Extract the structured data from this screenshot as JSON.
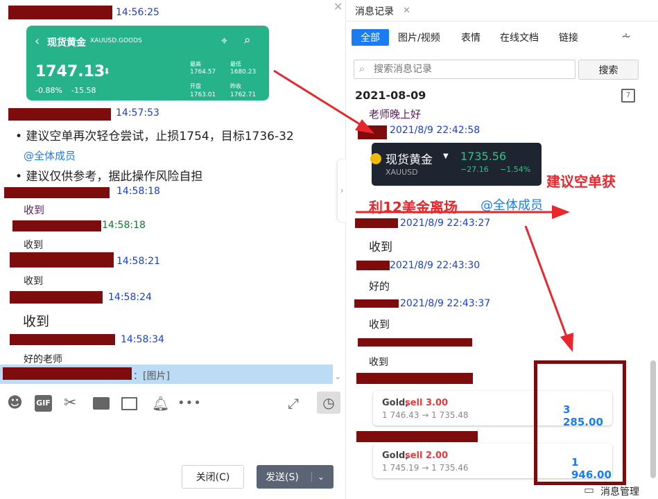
{
  "left": {
    "messages": [
      {
        "time": "14:56:25"
      },
      {
        "time": "14:57:53",
        "lines": [
          "建议空单再次轻仓尝试，止损1754，目标1736-32",
          "@全体成员",
          "建议仅供参考，据此操作风险自担"
        ]
      },
      {
        "time": "14:58:18",
        "text": "收到"
      },
      {
        "time": "14:58:18",
        "text": "收到"
      },
      {
        "time": "14:58:21",
        "text": "收到"
      },
      {
        "time": "14:58:24",
        "text": "收到"
      },
      {
        "time": "14:58:34",
        "text": "好的老师"
      }
    ],
    "reply_preview": "：[图片]",
    "gold_card": {
      "title": "现货黄金",
      "code": "XAUUSD.GOODS",
      "price": "1747.13",
      "change_pct": "-0.88%",
      "change_abs": "-15.58",
      "high_label": "最高",
      "high": "1764.57",
      "low_label": "最低",
      "low": "1680.23",
      "open_label": "开盘",
      "open": "1763.01",
      "prev_label": "昨收",
      "prev": "1762.71"
    },
    "buttons": {
      "close": "关闭(C)",
      "send": "发送(S)"
    }
  },
  "right": {
    "tab_title": "消息记录",
    "filters": [
      "全部",
      "图片/视频",
      "表情",
      "在线文档",
      "链接"
    ],
    "search_placeholder": "搜索消息记录",
    "search_button": "搜索",
    "date": "2021-08-09",
    "first_msg": "老师晚上好",
    "entries": [
      {
        "time": "2021/8/9 22:42:58"
      },
      {
        "time": "2021/8/9 22:43:27",
        "text": "收到"
      },
      {
        "time": "2021/8/9 22:43:30",
        "text": "好的"
      },
      {
        "time": "2021/8/9 22:43:37",
        "text": "收到"
      },
      {
        "text": "收到"
      }
    ],
    "gold_widget": {
      "title": "现货黄金",
      "code": "XAUUSD",
      "price": "1735.56",
      "change_abs": "−27.16",
      "change_pct": "−1.54%"
    },
    "overlay_text_1": "建议空单获",
    "overlay_text_2": "利12美金离场",
    "overlay_at": "@全体成员",
    "trades": [
      {
        "symbol": "Gold,",
        "side": "sell 3.00",
        "route": "1 746.43 → 1 735.48",
        "profit": "3 285.00"
      },
      {
        "symbol": "Gold,",
        "side": "sell 2.00",
        "route": "1 745.19 → 1 735.46",
        "profit": "1 946.00"
      }
    ],
    "footer": "消息管理"
  },
  "colors": {
    "accent": "#1a7cf0",
    "gold_card": "#27b38a",
    "redact": "#7d0c0c",
    "overlay_red": "#e8262c"
  }
}
